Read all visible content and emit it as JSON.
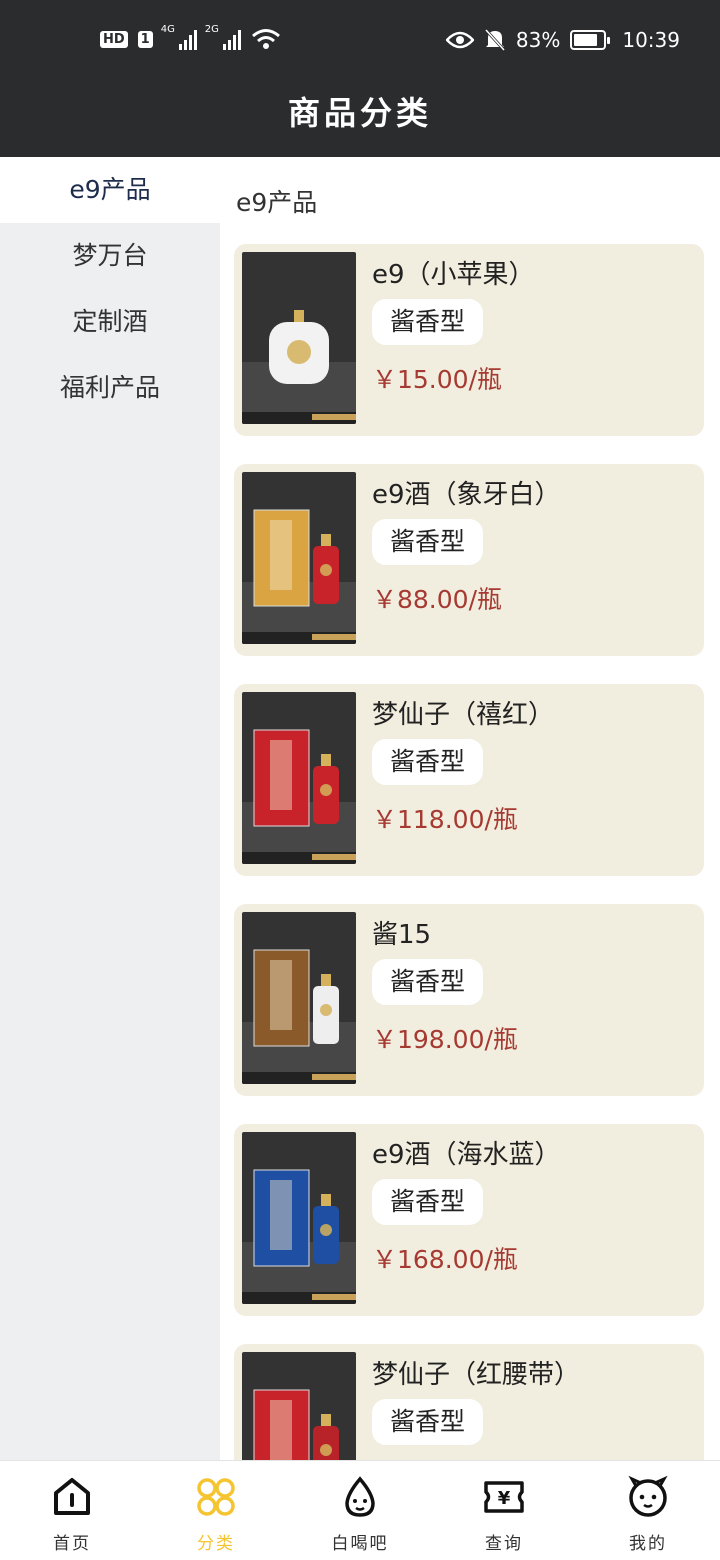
{
  "status_bar": {
    "hd": "HD",
    "sim1": "1",
    "net1": "4G",
    "net2": "2G",
    "battery_percent": "83%",
    "battery_level": 0.83,
    "time": "10:39"
  },
  "header": {
    "title": "商品分类"
  },
  "sidebar": {
    "items": [
      {
        "label": "e9产品",
        "active": true
      },
      {
        "label": "梦万台",
        "active": false
      },
      {
        "label": "定制酒",
        "active": false
      },
      {
        "label": "福利产品",
        "active": false
      }
    ]
  },
  "content": {
    "section_title": "e9产品",
    "products": [
      {
        "name": "e9（小苹果）",
        "tag": "酱香型",
        "price": "￥15.00/瓶",
        "bottle_color": "#f2f2f2",
        "box_color": ""
      },
      {
        "name": "e9酒（象牙白）",
        "tag": "酱香型",
        "price": "￥88.00/瓶",
        "bottle_color": "#c8232a",
        "box_color": "#d9a441"
      },
      {
        "name": "梦仙子（禧红）",
        "tag": "酱香型",
        "price": "￥118.00/瓶",
        "bottle_color": "#c8232a",
        "box_color": "#c8232a"
      },
      {
        "name": "酱15",
        "tag": "酱香型",
        "price": "￥198.00/瓶",
        "bottle_color": "#eeeeee",
        "box_color": "#8a5a2b"
      },
      {
        "name": "e9酒（海水蓝）",
        "tag": "酱香型",
        "price": "￥168.00/瓶",
        "bottle_color": "#1e4fa3",
        "box_color": "#1e4fa3"
      },
      {
        "name": "梦仙子（红腰带）",
        "tag": "酱香型",
        "price": "",
        "bottle_color": "#b8232a",
        "box_color": "#c8232a"
      }
    ]
  },
  "tabbar": {
    "items": [
      {
        "label": "首页",
        "icon": "home-icon",
        "active": false
      },
      {
        "label": "分类",
        "icon": "category-icon",
        "active": true
      },
      {
        "label": "白喝吧",
        "icon": "drink-icon",
        "active": false
      },
      {
        "label": "查询",
        "icon": "ticket-icon",
        "active": false
      },
      {
        "label": "我的",
        "icon": "profile-icon",
        "active": false
      }
    ]
  },
  "colors": {
    "header_bg": "#2b2c2e",
    "card_bg": "#f2eedf",
    "price": "#a63a32",
    "accent": "#f4c530"
  }
}
